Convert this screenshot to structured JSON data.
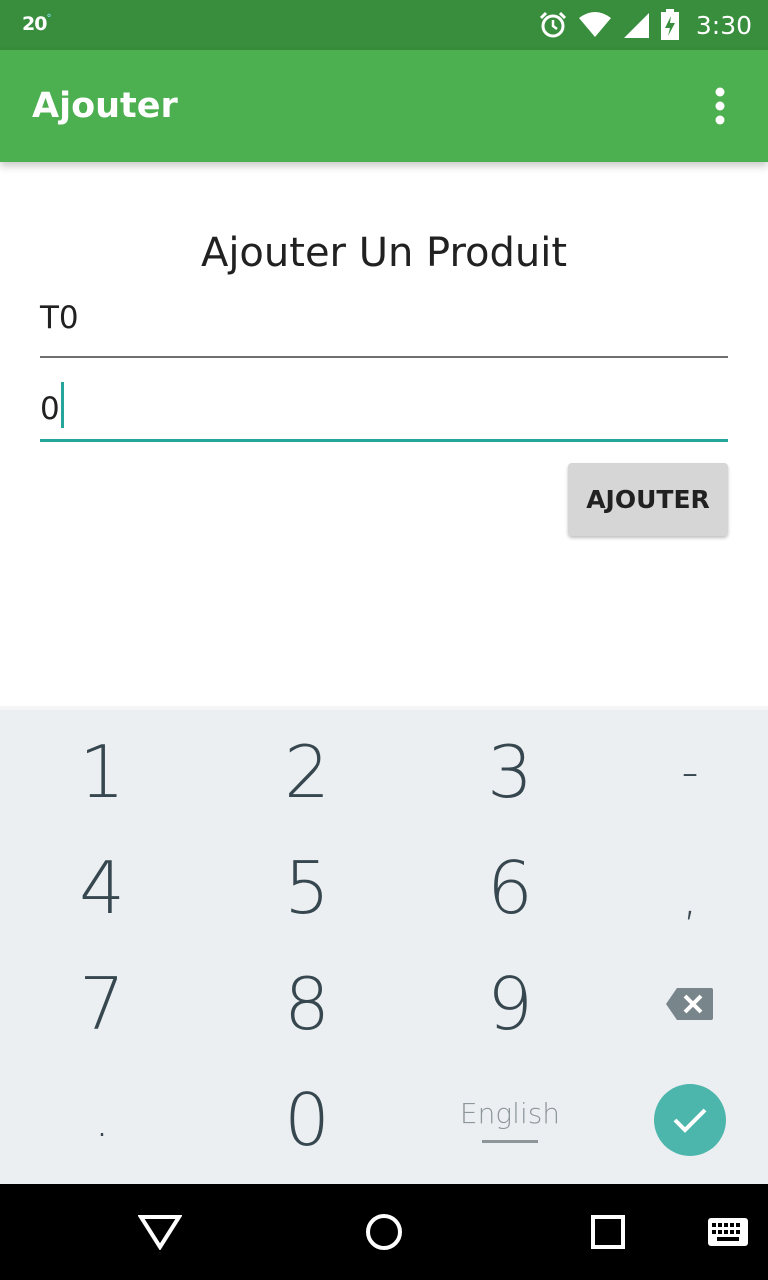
{
  "status_bar": {
    "left_text": "20",
    "degree": "°",
    "time": "3:30",
    "icons": [
      "alarm-icon",
      "wifi-icon",
      "signal-icon",
      "battery-charging-icon"
    ]
  },
  "app_bar": {
    "title": "Ajouter",
    "overflow_icon": "more-vert-icon"
  },
  "form": {
    "heading": "Ajouter Un Produit",
    "name_value": "T0",
    "quantity_value": "0",
    "add_button_label": "AJOUTER"
  },
  "keyboard": {
    "keys": [
      "1",
      "2",
      "3",
      "-",
      "4",
      "5",
      "6",
      ",",
      "7",
      "8",
      "9",
      "delete",
      ".",
      "0",
      "English",
      "done"
    ],
    "language_label": "English",
    "colors": {
      "background": "#eceff1",
      "key_text": "#37474f",
      "done_button": "#4db6ac"
    }
  },
  "nav_bar": {
    "icons": [
      "back-icon",
      "home-icon",
      "recents-icon",
      "keyboard-switch-icon"
    ]
  },
  "colors": {
    "status_bar": "#388e3c",
    "app_bar": "#4caf50",
    "accent": "#26a69a"
  }
}
